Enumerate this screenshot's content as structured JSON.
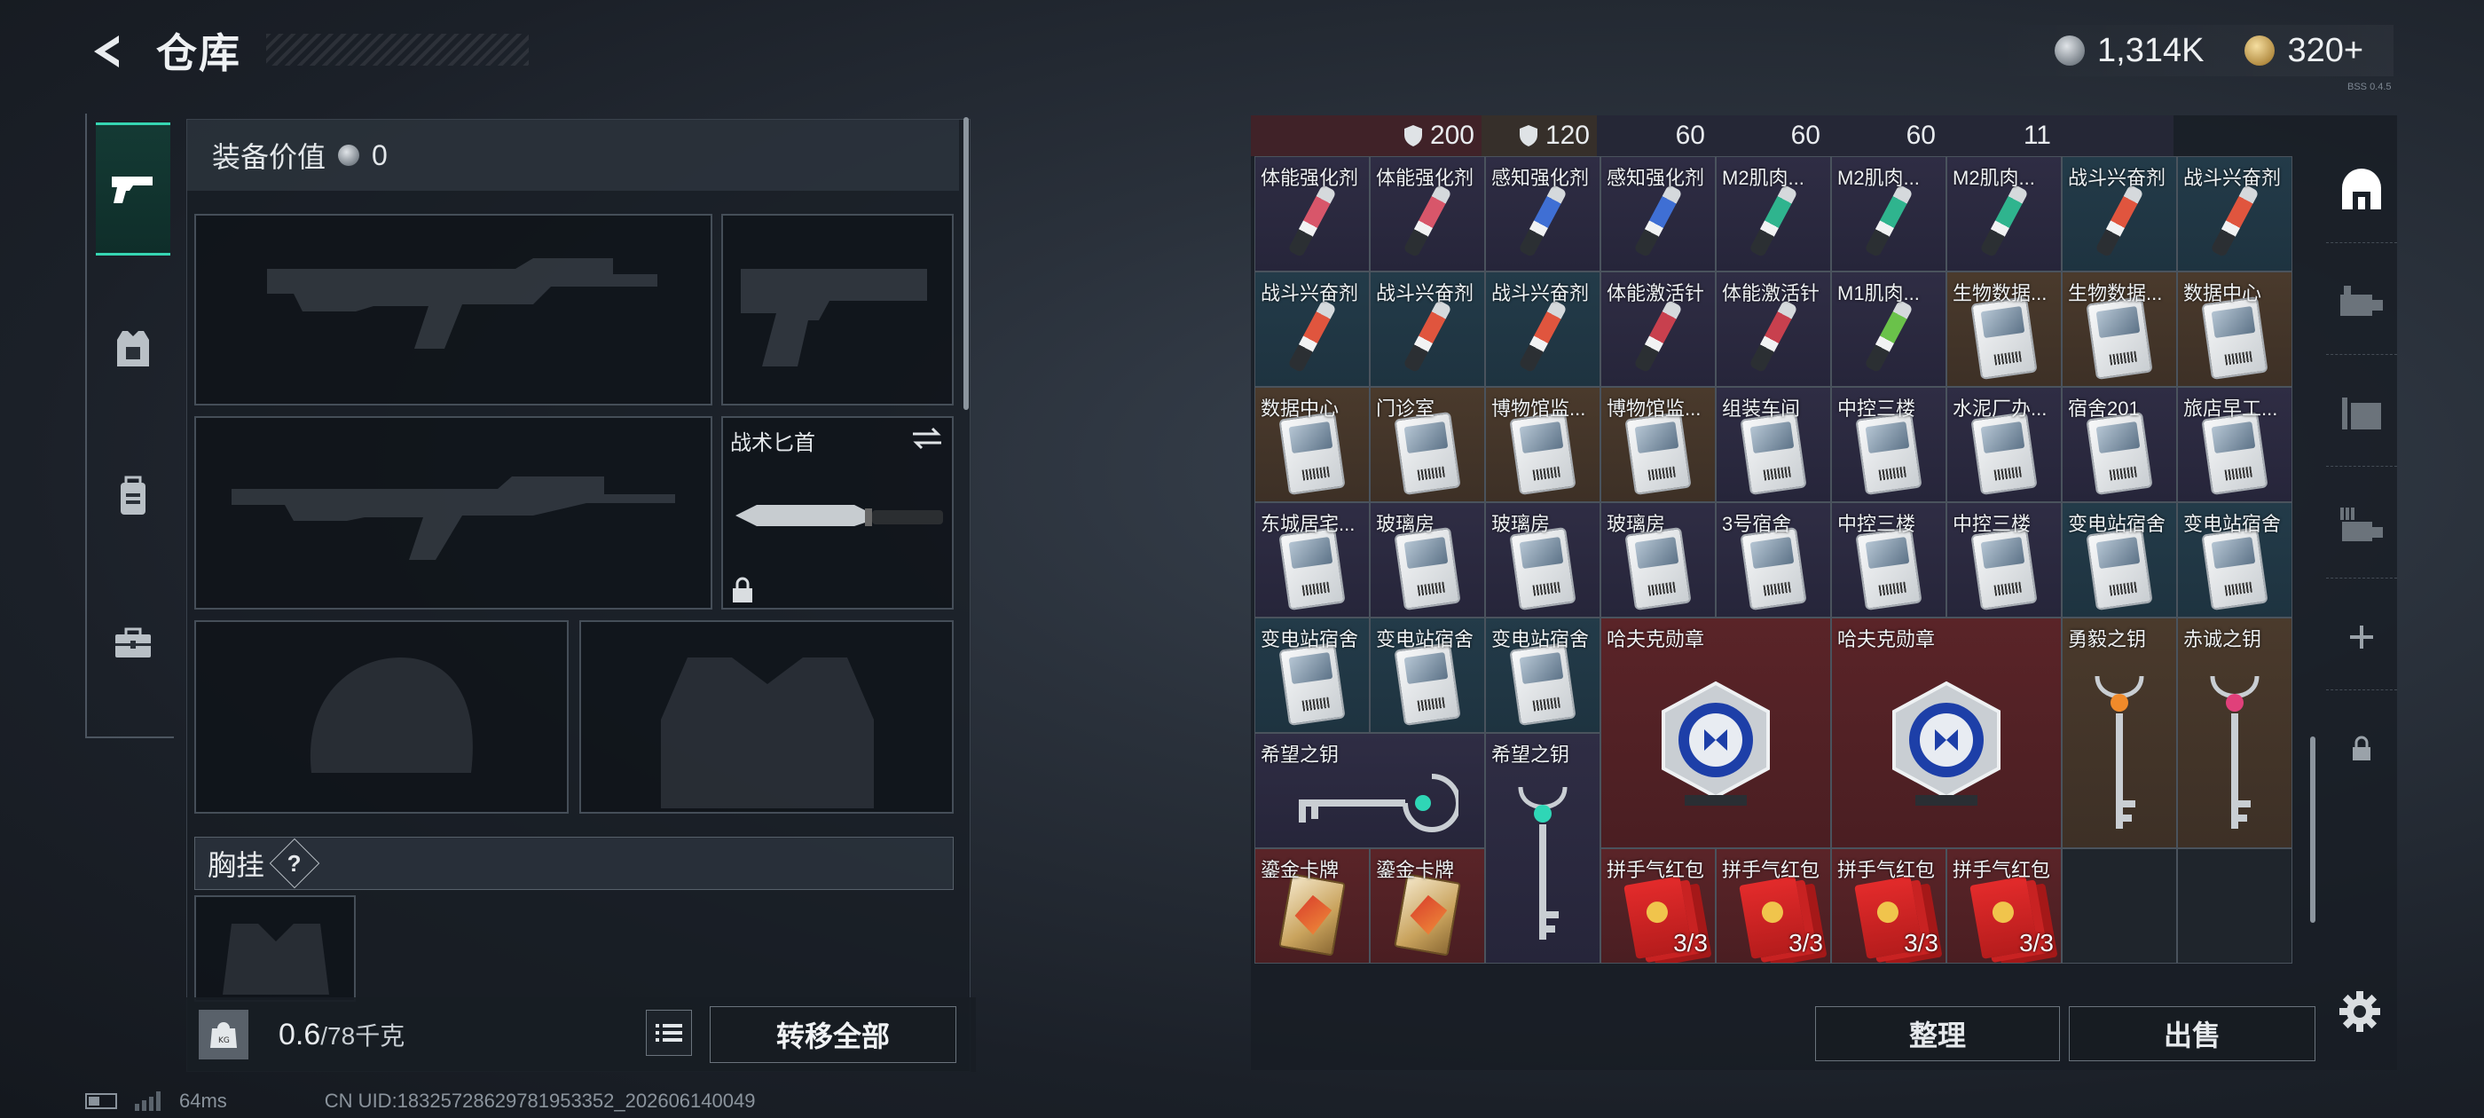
{
  "header": {
    "title": "仓库",
    "currency": [
      {
        "icon": "silver-coin-icon",
        "amount": "1,314K"
      },
      {
        "icon": "gold-coin-icon",
        "amount": "320+"
      }
    ],
    "tiny_text": "BSS 0.4.5"
  },
  "categories": [
    {
      "icon": "pistol-icon",
      "active": true
    },
    {
      "icon": "armor-vest-icon",
      "active": false
    },
    {
      "icon": "backpack-icon",
      "active": false
    },
    {
      "icon": "toolbox-icon",
      "active": false
    }
  ],
  "loadout": {
    "equip_value_label": "装备价值",
    "equip_value": "0",
    "knife_label": "战术匕首",
    "chest_label": "胸挂",
    "help": "?"
  },
  "weight": {
    "current": "0.6",
    "max": "/78千克"
  },
  "buttons": {
    "transfer_all": "转移全部",
    "sort": "整理",
    "sell": "出售"
  },
  "status": {
    "ping": "64ms",
    "uid": "CN UID:18325728629781953352_202606140049"
  },
  "storage": {
    "header_values": [
      "200",
      "",
      "120",
      "60",
      "60",
      "60",
      "11",
      ""
    ],
    "items": [
      {
        "name": "体能强化剂",
        "kind": "syringe",
        "color": "#d8566a",
        "bg": "purple"
      },
      {
        "name": "体能强化剂",
        "kind": "syringe",
        "color": "#d8566a",
        "bg": "purple"
      },
      {
        "name": "感知强化剂",
        "kind": "syringe",
        "color": "#3f6fd4",
        "bg": "purple"
      },
      {
        "name": "感知强化剂",
        "kind": "syringe",
        "color": "#3f6fd4",
        "bg": "purple"
      },
      {
        "name": "M2肌肉...",
        "kind": "syringe",
        "color": "#2fb48e",
        "bg": "purple"
      },
      {
        "name": "M2肌肉...",
        "kind": "syringe",
        "color": "#2fb48e",
        "bg": "purple"
      },
      {
        "name": "M2肌肉...",
        "kind": "syringe",
        "color": "#2fb48e",
        "bg": "purple"
      },
      {
        "name": "战斗兴奋剂",
        "kind": "syringe",
        "color": "#e0553e",
        "bg": "teal"
      },
      {
        "name": "战斗兴奋剂",
        "kind": "syringe",
        "color": "#e0553e",
        "bg": "teal"
      },
      {
        "name": "战斗兴奋剂",
        "kind": "syringe",
        "color": "#e0553e",
        "bg": "teal"
      },
      {
        "name": "战斗兴奋剂",
        "kind": "syringe",
        "color": "#e0553e",
        "bg": "teal"
      },
      {
        "name": "战斗兴奋剂",
        "kind": "syringe",
        "color": "#e0553e",
        "bg": "teal"
      },
      {
        "name": "体能激活针",
        "kind": "syringe",
        "color": "#c8404e",
        "bg": "purple"
      },
      {
        "name": "体能激活针",
        "kind": "syringe",
        "color": "#c8404e",
        "bg": "purple"
      },
      {
        "name": "M1肌肉...",
        "kind": "syringe",
        "color": "#6ac24a",
        "bg": "purple"
      },
      {
        "name": "生物数据...",
        "kind": "card",
        "bg": "brown"
      },
      {
        "name": "生物数据...",
        "kind": "card",
        "bg": "brown"
      },
      {
        "name": "数据中心",
        "kind": "card",
        "bg": "brown"
      },
      {
        "name": "数据中心",
        "kind": "card",
        "bg": "brown"
      },
      {
        "name": "门诊室",
        "kind": "card",
        "bg": "brown"
      },
      {
        "name": "博物馆监...",
        "kind": "card",
        "bg": "brown"
      },
      {
        "name": "博物馆监...",
        "kind": "card",
        "bg": "brown"
      },
      {
        "name": "组装车间",
        "kind": "card",
        "bg": "purple"
      },
      {
        "name": "中控三楼",
        "kind": "card",
        "bg": "purple"
      },
      {
        "name": "水泥厂办...",
        "kind": "card",
        "bg": "purple"
      },
      {
        "name": "宿舍201",
        "kind": "card",
        "bg": "purple"
      },
      {
        "name": "旅店早工...",
        "kind": "card",
        "bg": "purple"
      },
      {
        "name": "东城居宅...",
        "kind": "card",
        "bg": "purple"
      },
      {
        "name": "玻璃房",
        "kind": "card",
        "bg": "purple"
      },
      {
        "name": "玻璃房",
        "kind": "card",
        "bg": "purple"
      },
      {
        "name": "玻璃房",
        "kind": "card",
        "bg": "purple"
      },
      {
        "name": "3号宿舍",
        "kind": "card",
        "bg": "purple"
      },
      {
        "name": "中控三楼",
        "kind": "card",
        "bg": "purple"
      },
      {
        "name": "中控三楼",
        "kind": "card",
        "bg": "purple"
      },
      {
        "name": "变电站宿舍",
        "kind": "card",
        "bg": "teal"
      },
      {
        "name": "变电站宿舍",
        "kind": "card",
        "bg": "teal"
      },
      {
        "name": "变电站宿舍",
        "kind": "card",
        "bg": "teal"
      },
      {
        "name": "变电站宿舍",
        "kind": "card",
        "bg": "teal"
      },
      {
        "name": "变电站宿舍",
        "kind": "card",
        "bg": "teal"
      },
      {
        "name": "哈夫克勋章",
        "kind": "medal",
        "bg": "red"
      },
      {
        "name": "哈夫克勋章",
        "kind": "medal",
        "bg": "red"
      },
      {
        "name": "勇毅之钥",
        "kind": "key-orange",
        "bg": "brown"
      },
      {
        "name": "赤诚之钥",
        "kind": "key-pink",
        "bg": "brown"
      },
      {
        "name": "希望之钥",
        "kind": "key-teal-wide",
        "bg": "purple"
      },
      {
        "name": "希望之钥",
        "kind": "key-teal-tall",
        "bg": "purple"
      },
      {
        "name": "鎏金卡牌",
        "kind": "goldcard",
        "bg": "red"
      },
      {
        "name": "鎏金卡牌",
        "kind": "goldcard",
        "bg": "red"
      },
      {
        "name": "拼手气红包",
        "kind": "envelope",
        "qty": "3/3",
        "bg": "red"
      },
      {
        "name": "拼手气红包",
        "kind": "envelope",
        "qty": "3/3",
        "bg": "red"
      },
      {
        "name": "拼手气红包",
        "kind": "envelope",
        "qty": "3/3",
        "bg": "red"
      },
      {
        "name": "拼手气红包",
        "kind": "envelope",
        "qty": "3/3",
        "bg": "red"
      }
    ]
  },
  "right_rail": [
    {
      "icon": "storage-home-icon"
    },
    {
      "icon": "storage-tab-1-icon"
    },
    {
      "icon": "storage-tab-2-icon"
    },
    {
      "icon": "storage-tab-3-icon"
    },
    {
      "icon": "add-icon"
    },
    {
      "icon": "lock-icon"
    }
  ]
}
